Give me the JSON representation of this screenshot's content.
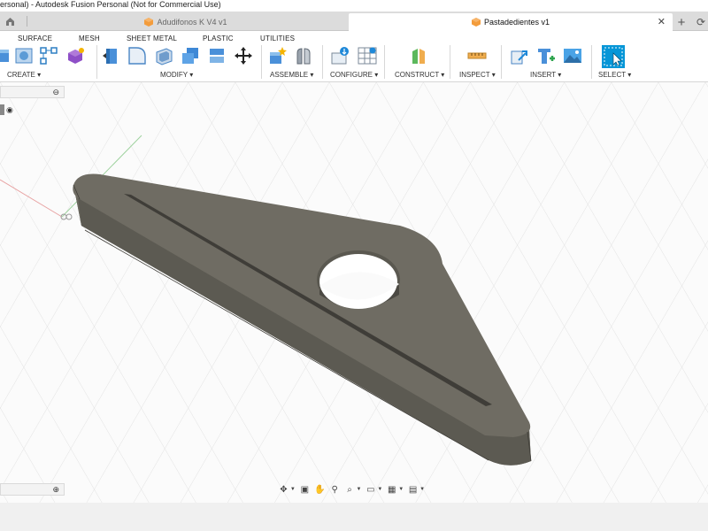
{
  "window": {
    "title": "ersonal) - Autodesk Fusion Personal (Not for Commercial Use)"
  },
  "tabs": [
    {
      "label": "Adudifonos K V4 v1",
      "active": false
    },
    {
      "label": "Pastadedientes v1",
      "active": true
    }
  ],
  "workspace_tabs": [
    "SURFACE",
    "MESH",
    "SHEET METAL",
    "PLASTIC",
    "UTILITIES"
  ],
  "toolbar_groups": {
    "create": "CREATE ▾",
    "modify": "MODIFY ▾",
    "assemble": "ASSEMBLE ▾",
    "configure": "CONFIGURE ▾",
    "construct": "CONSTRUCT ▾",
    "inspect": "INSPECT ▾",
    "insert": "INSERT ▾",
    "select": "SELECT ▾"
  },
  "icons": {
    "home": "home-icon",
    "new_tab": "plus-icon",
    "tab_close": "close-icon",
    "orbit": "orbit-icon",
    "pan": "pan-icon",
    "zoom": "zoom-icon",
    "display": "display-settings-icon",
    "grid": "grid-icon",
    "viewports": "viewports-icon"
  },
  "colors": {
    "accent": "#0696d7",
    "model_top": "#6e6b62",
    "model_side": "#5b5951",
    "tab_bar": "#dcdcdc"
  }
}
